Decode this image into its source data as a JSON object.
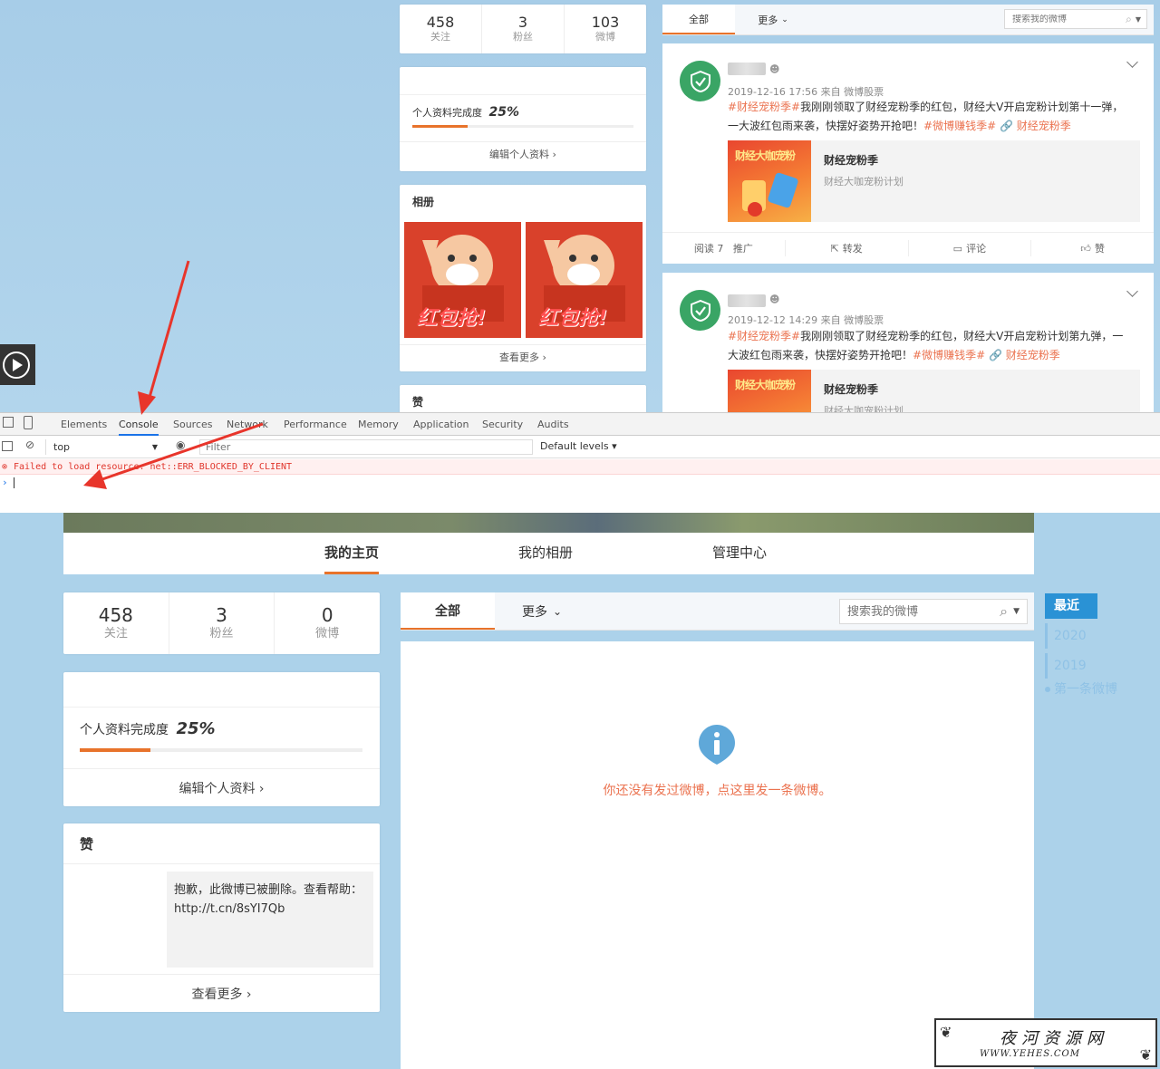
{
  "top": {
    "stats": [
      {
        "num": "458",
        "label": "关注"
      },
      {
        "num": "3",
        "label": "粉丝"
      },
      {
        "num": "103",
        "label": "微博"
      }
    ],
    "profile": {
      "label": "个人资料完成度",
      "percent": "25%",
      "progress": 0.25,
      "edit_label": "编辑个人资料 ›"
    },
    "album": {
      "title": "相册",
      "more": "查看更多 ›",
      "img_text": "红包抢!"
    },
    "like_title": "赞",
    "tabs": {
      "all": "全部",
      "more": "更多"
    },
    "search_placeholder": "搜索我的微博",
    "posts": [
      {
        "time": "2019-12-16 17:56 来自 微博股票",
        "tag1": "#财经宠粉季#",
        "text": "我刚刚领取了财经宠粉季的红包，财经大V开启宠粉计划第十一弹，一大波红包雨来袭，快摆好姿势开抢吧！",
        "tag2": "#微博赚钱季#",
        "tag3": "🔗 财经宠粉季",
        "share_title": "财经宠粉季",
        "share_desc": "财经大咖宠粉计划",
        "thumb_text": "财经大咖宠粉",
        "actions": [
          "阅读 7   推广",
          "转发",
          "评论",
          "赞"
        ]
      },
      {
        "time": "2019-12-12 14:29 来自 微博股票",
        "tag1": "#财经宠粉季#",
        "text": "我刚刚领取了财经宠粉季的红包，财经大V开启宠粉计划第九弹，一大波红包雨来袭，快摆好姿势开抢吧！",
        "tag2": "#微博赚钱季#",
        "tag3": "🔗 财经宠粉季",
        "share_title": "财经宠粉季",
        "share_desc": "财经大咖宠粉计划",
        "thumb_text": "财经大咖宠粉"
      }
    ]
  },
  "devtools": {
    "tabs": [
      "Elements",
      "Console",
      "Sources",
      "Network",
      "Performance",
      "Memory",
      "Application",
      "Security",
      "Audits"
    ],
    "active_tab": "Console",
    "context": "top",
    "filter_placeholder": "Filter",
    "levels": "Default levels ▾",
    "error": "Failed to load resource: net::ERR_BLOCKED_BY_CLIENT",
    "prompt": "›"
  },
  "bottom": {
    "nav": [
      "我的主页",
      "我的相册",
      "管理中心"
    ],
    "stats": [
      {
        "num": "458",
        "label": "关注"
      },
      {
        "num": "3",
        "label": "粉丝"
      },
      {
        "num": "0",
        "label": "微博"
      }
    ],
    "profile": {
      "label": "个人资料完成度",
      "percent": "25%",
      "progress": 0.25,
      "edit_label": "编辑个人资料 ›"
    },
    "like": {
      "title": "赞",
      "deleted": "抱歉，此微博已被删除。查看帮助：http://t.cn/8sYI7Qb",
      "more": "查看更多 ›"
    },
    "tabs": {
      "all": "全部",
      "more": "更多"
    },
    "search_placeholder": "搜索我的微博",
    "empty_message": "你还没有发过微博，点这里发一条微博。",
    "timeline": [
      "最近",
      "2020",
      "2019",
      "第一条微博"
    ]
  },
  "watermark": {
    "line1": "夜河资源网",
    "line2": "WWW.YEHES.COM"
  },
  "colors": {
    "accent": "#e8732b",
    "tag": "#eb7350",
    "shield": "#3aa565",
    "timeline": "#2a92d5"
  }
}
